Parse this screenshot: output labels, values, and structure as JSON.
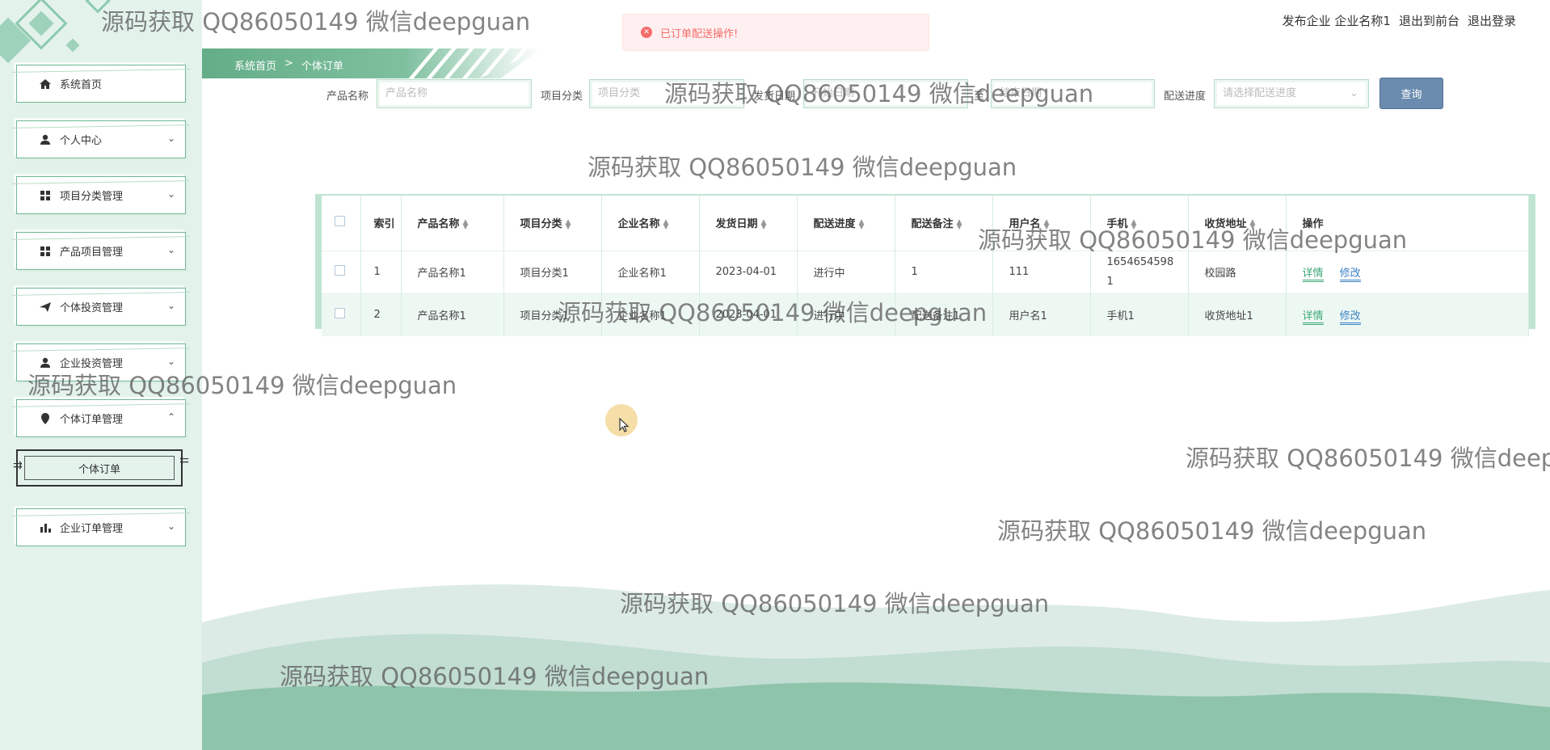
{
  "colors": {
    "accent_green": "#64ad88",
    "query_button": "#6b8cae",
    "toast_error": "#f56c6c"
  },
  "topbar": {
    "links": [
      "发布企业 企业名称1",
      "退出到前台",
      "退出登录"
    ]
  },
  "toast": {
    "icon": "close-circle-icon",
    "message": "已订单配送操作!"
  },
  "breadcrumb": {
    "home": "系统首页",
    "separator": ">",
    "current": "个体订单"
  },
  "sidebar": {
    "items": [
      {
        "label": "系统首页",
        "icon": "home-icon"
      },
      {
        "label": "个人中心",
        "icon": "user-icon"
      },
      {
        "label": "项目分类管理",
        "icon": "grid-icon"
      },
      {
        "label": "产品项目管理",
        "icon": "grid-icon"
      },
      {
        "label": "个体投资管理",
        "icon": "send-icon"
      },
      {
        "label": "企业投资管理",
        "icon": "user-icon"
      },
      {
        "label": "个体订单管理",
        "icon": "location-pin-icon"
      },
      {
        "label": "企业订单管理",
        "icon": "bar-chart-icon"
      }
    ],
    "submenu": {
      "label": "个体订单"
    }
  },
  "search": {
    "product_name_label": "产品名称",
    "product_name_placeholder": "产品名称",
    "category_label": "项目分类",
    "category_placeholder": "项目分类",
    "ship_date_label": "发货日期",
    "ship_date_start_placeholder": "开始日期",
    "ship_date_to": "至",
    "ship_date_end_placeholder": "结束日期",
    "progress_label": "配送进度",
    "progress_placeholder": "请选择配送进度",
    "query_button": "查询"
  },
  "table": {
    "columns": [
      "索引",
      "产品名称",
      "项目分类",
      "企业名称",
      "发货日期",
      "配送进度",
      "配送备注",
      "用户名",
      "手机",
      "收货地址",
      "操作"
    ],
    "rows": [
      {
        "index": "1",
        "product": "产品名称1",
        "category": "项目分类1",
        "company": "企业名称1",
        "date": "2023-04-01",
        "progress": "进行中",
        "remark": "1",
        "user": "111",
        "phone": "16546545981",
        "address": "校园路"
      },
      {
        "index": "2",
        "product": "产品名称1",
        "category": "项目分类1",
        "company": "企业名称1",
        "date": "2023-04-01",
        "progress": "进行中",
        "remark": "配送备注1",
        "user": "用户名1",
        "phone": "手机1",
        "address": "收货地址1"
      }
    ],
    "actions": {
      "detail": "详情",
      "edit": "修改"
    }
  },
  "watermark": "源码获取 QQ86050149 微信deepguan"
}
